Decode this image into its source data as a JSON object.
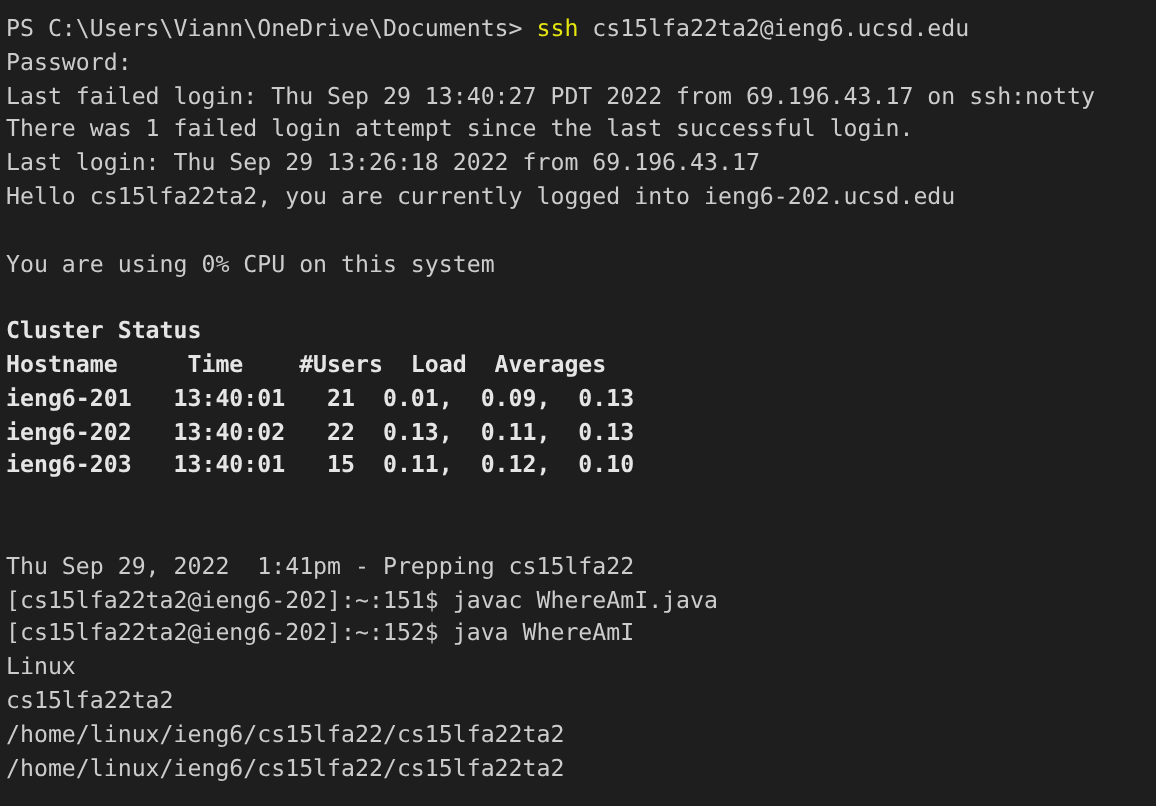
{
  "terminal": {
    "lines": [
      {
        "kind": "prompt",
        "prompt": "PS C:\\Users\\Viann\\OneDrive\\Documents>",
        "command": "ssh",
        "args": "cs15lfa22ta2@ieng6.ucsd.edu"
      },
      {
        "kind": "text",
        "text": "Password:"
      },
      {
        "kind": "text",
        "text": "Last failed login: Thu Sep 29 13:40:27 PDT 2022 from 69.196.43.17 on ssh:notty"
      },
      {
        "kind": "text",
        "text": "There was 1 failed login attempt since the last successful login."
      },
      {
        "kind": "text",
        "text": "Last login: Thu Sep 29 13:26:18 2022 from 69.196.43.17"
      },
      {
        "kind": "text",
        "text": "Hello cs15lfa22ta2, you are currently logged into ieng6-202.ucsd.edu"
      },
      {
        "kind": "blank"
      },
      {
        "kind": "text",
        "text": "You are using 0% CPU on this system"
      },
      {
        "kind": "blank"
      },
      {
        "kind": "bold",
        "text": "Cluster Status"
      },
      {
        "kind": "bold",
        "text": "Hostname     Time    #Users  Load  Averages"
      },
      {
        "kind": "bold",
        "text": "ieng6-201   13:40:01   21  0.01,  0.09,  0.13"
      },
      {
        "kind": "bold",
        "text": "ieng6-202   13:40:02   22  0.13,  0.11,  0.13"
      },
      {
        "kind": "bold",
        "text": "ieng6-203   13:40:01   15  0.11,  0.12,  0.10"
      },
      {
        "kind": "blank"
      },
      {
        "kind": "blank"
      },
      {
        "kind": "text",
        "text": "Thu Sep 29, 2022  1:41pm - Prepping cs15lfa22"
      },
      {
        "kind": "text",
        "text": "[cs15lfa22ta2@ieng6-202]:~:151$ javac WhereAmI.java"
      },
      {
        "kind": "text",
        "text": "[cs15lfa22ta2@ieng6-202]:~:152$ java WhereAmI"
      },
      {
        "kind": "text",
        "text": "Linux"
      },
      {
        "kind": "text",
        "text": "cs15lfa22ta2"
      },
      {
        "kind": "text",
        "text": "/home/linux/ieng6/cs15lfa22/cs15lfa22ta2"
      },
      {
        "kind": "text",
        "text": "/home/linux/ieng6/cs15lfa22/cs15lfa22ta2"
      }
    ]
  }
}
